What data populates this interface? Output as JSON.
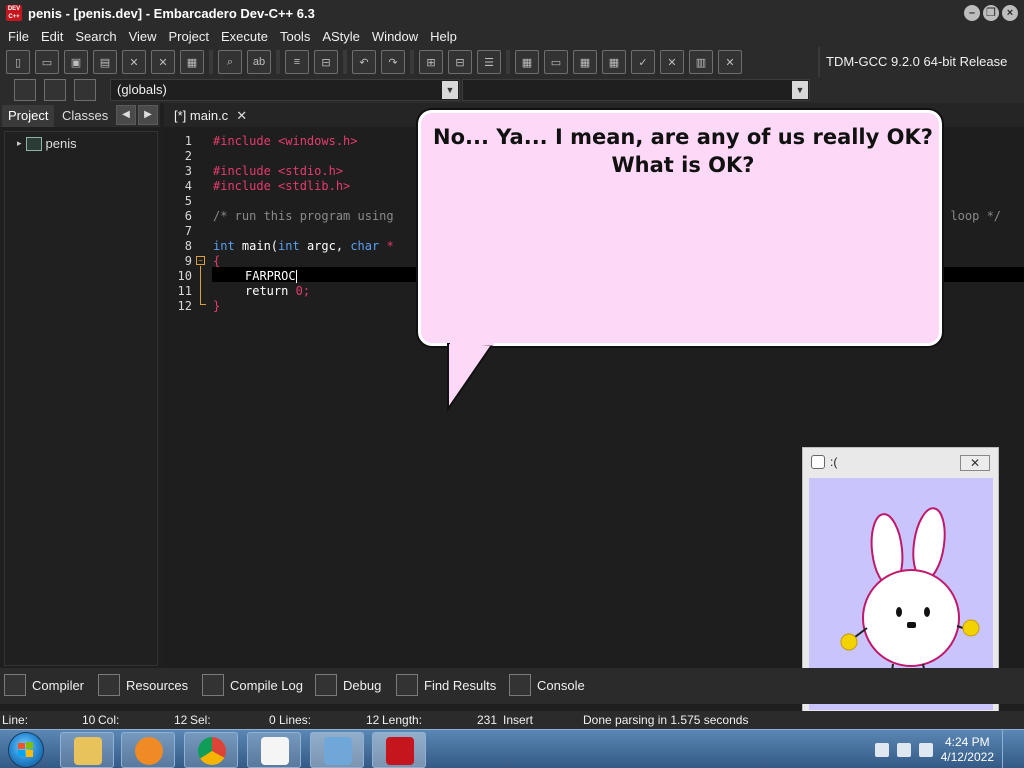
{
  "window": {
    "title": "penis - [penis.dev] - Embarcadero Dev-C++ 6.3",
    "app_icon_text": "DEV C++",
    "controls": [
      "minimize",
      "restore",
      "close"
    ]
  },
  "menu": [
    "File",
    "Edit",
    "Search",
    "View",
    "Project",
    "Execute",
    "Tools",
    "AStyle",
    "Window",
    "Help"
  ],
  "toolbar": {
    "compiler_profile": "TDM-GCC 9.2.0 64-bit Release"
  },
  "toolbar2": {
    "scope_combo": "(globals)",
    "member_combo": ""
  },
  "left_panel": {
    "tabs": [
      "Project",
      "Classes"
    ],
    "active_tab": "Project",
    "tree_root": "penis"
  },
  "editor": {
    "tab_label": "[*] main.c",
    "tab_close": "✕",
    "line_numbers": [
      "1",
      "2",
      "3",
      "4",
      "5",
      "6",
      "7",
      "8",
      "9",
      "10",
      "11",
      "12"
    ],
    "lines": {
      "l1": "#include <windows.h>",
      "l3": "#include <stdio.h>",
      "l4": "#include <stdlib.h>",
      "l6a": "/* run this program using",
      "l6b": "t loop */",
      "l8_kw1": "int",
      "l8_fn": " main(",
      "l8_kw2": "int",
      "l8_arg": " argc, ",
      "l8_kw3": "char",
      "l8_rest": " *",
      "l9": "{",
      "l10": "FARPROC",
      "l11_kw": "return",
      "l11_num": " 0",
      "l11_semi": ";",
      "l12": "}"
    }
  },
  "bottom_tabs": [
    "Compiler",
    "Resources",
    "Compile Log",
    "Debug",
    "Find Results",
    "Console"
  ],
  "status": {
    "line_label": "Line:",
    "line_value": "10",
    "col_label": "Col:",
    "col_value": "12",
    "sel_label": "Sel:",
    "sel_value": "0",
    "lines_label": "Lines:",
    "lines_value": "12",
    "length_label": "Length:",
    "length_value": "231",
    "mode": "Insert",
    "message": "Done parsing in 1.575 seconds"
  },
  "bubble": {
    "text": "No... Ya... I mean, are any of us really OK? What is OK?"
  },
  "bunny_window": {
    "title": ":(",
    "close": "✕"
  },
  "taskbar": {
    "time": "4:24 PM",
    "date": "4/12/2022",
    "apps": [
      "file-explorer",
      "media-player",
      "chrome",
      "bunny-app",
      "photo-viewer",
      "dev-cpp"
    ]
  },
  "colors": {
    "preprocessor": "#e63b6b",
    "keyword": "#5b9ef0",
    "comment": "#8a8a8a",
    "bubble_fill": "#fdd9f7",
    "bunny_bg": "#c9c4fb"
  }
}
